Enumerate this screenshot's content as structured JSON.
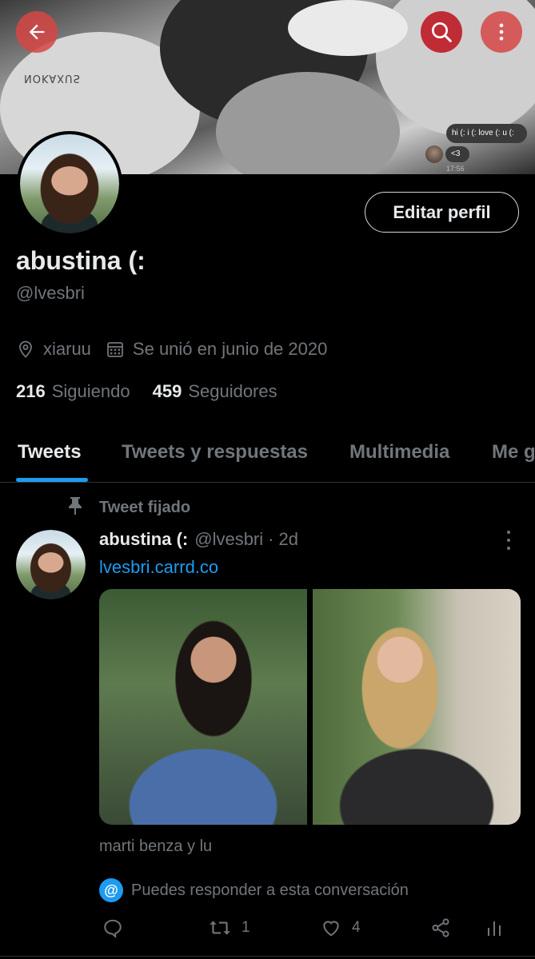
{
  "header": {
    "back_icon": "arrow-left-icon",
    "search_icon": "search-icon",
    "more_icon": "more-vertical-icon",
    "button_color": "#d64646"
  },
  "banner": {
    "mirrored_text": "NOKAXUS",
    "dm_message": "hi (: i (: love (: u (:",
    "dm_reply": "<3",
    "dm_time": "17:56"
  },
  "profile": {
    "display_name": "abustina (:",
    "handle": "@lvesbri",
    "edit_button": "Editar perfil",
    "location": "xiaruu",
    "joined": "Se unió en junio de 2020",
    "following_count": "216",
    "following_label": "Siguiendo",
    "followers_count": "459",
    "followers_label": "Seguidores"
  },
  "tabs": [
    {
      "label": "Tweets",
      "active": true
    },
    {
      "label": "Tweets y respuestas",
      "active": false
    },
    {
      "label": "Multimedia",
      "active": false
    },
    {
      "label": "Me g",
      "active": false
    }
  ],
  "tweet": {
    "pinned_label": "Tweet fijado",
    "author_name": "abustina (:",
    "author_handle": "@lvesbri",
    "separator": "·",
    "time": "2d",
    "link_text": "lvesbri.carrd.co",
    "caption": "marti benza y lu",
    "reply_note": "Puedes responder a esta conversación",
    "reply_badge": "@",
    "reply_count": "",
    "retweet_count": "1",
    "like_count": "4",
    "accent_color": "#1d9bf0"
  }
}
